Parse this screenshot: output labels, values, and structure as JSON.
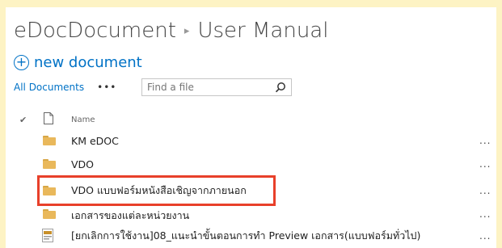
{
  "breadcrumb": {
    "site": "eDocDocument",
    "separator": "▸",
    "page": "User Manual"
  },
  "actions": {
    "new_document": "new document"
  },
  "view": {
    "current": "All Documents",
    "more": "•••",
    "search_placeholder": "Find a file"
  },
  "list": {
    "column_name": "Name",
    "items": [
      {
        "name": "KM eDOC",
        "type": "folder",
        "menu": "..."
      },
      {
        "name": "VDO",
        "type": "folder",
        "menu": "..."
      },
      {
        "name": "VDO แบบฟอร์มหนังสือเชิญจากภายนอก",
        "type": "folder",
        "menu": "...",
        "highlighted": true
      },
      {
        "name": "เอกสารของแต่ละหน่วยงาน",
        "type": "folder",
        "menu": "..."
      },
      {
        "name": "[ยกเลิกการใช้งาน]08_แนะนำขั้นตอนการทำ Preview เอกสาร(แบบฟอร์มทั่วไป)",
        "type": "file",
        "menu": "..."
      }
    ]
  },
  "colors": {
    "accent": "#0072c6",
    "background": "#fdf3c4",
    "folder": "#e9b85b",
    "highlight_border": "#e8402a"
  }
}
